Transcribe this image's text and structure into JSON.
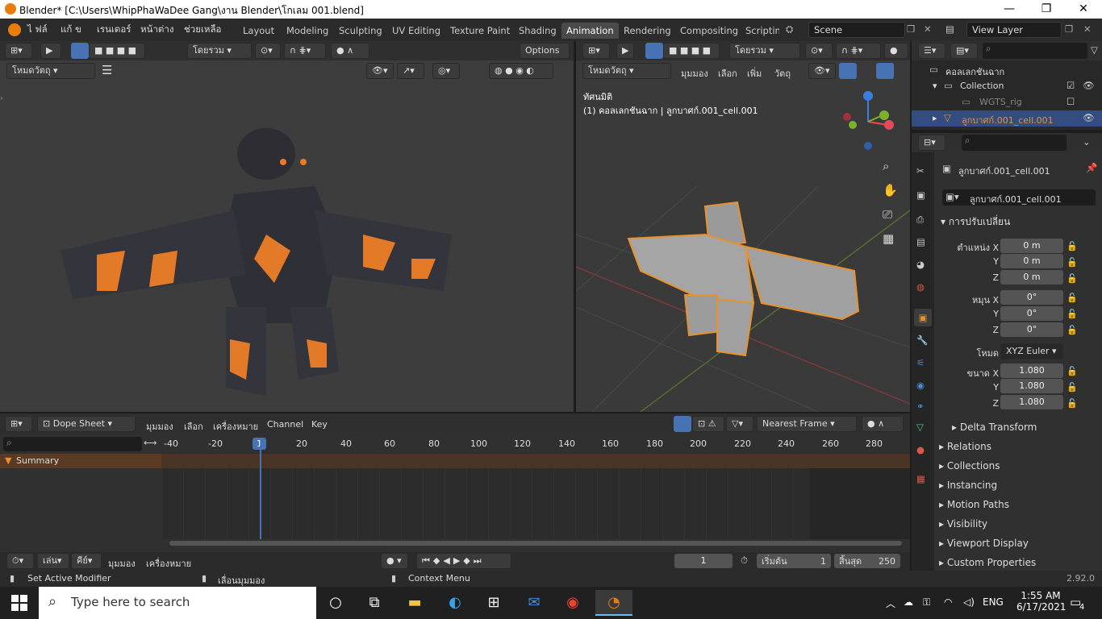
{
  "window": {
    "title": "Blender* [C:\\Users\\WhipPhaWaDee Gang\\งาน Blender\\โกเลม 001.blend]",
    "min": "—",
    "max": "❐",
    "close": "✕"
  },
  "menu": [
    "ไ ฟล์",
    "แก้ ข",
    "เรนเดอร์",
    "หน้าต่าง",
    "ช่วยเหลือ"
  ],
  "workspaces": [
    "Layout",
    "Modeling",
    "Sculpting",
    "UV Editing",
    "Texture Paint",
    "Shading",
    "Animation",
    "Rendering",
    "Compositing",
    "Scriptin"
  ],
  "active_workspace": "Animation",
  "scene": "Scene",
  "view_layer": "View Layer",
  "left_vp": {
    "orient": "โดยรวม",
    "mode": "โหมดวัตถุ",
    "options": "Options"
  },
  "right_vp": {
    "orient": "โดยรวม",
    "mode": "โหมดวัตถุ",
    "menus": [
      "มุมมอง",
      "เลือก",
      "เพิ่ม",
      "วัตถุ"
    ],
    "view_name": "ทัศนมิติ",
    "info": "(1) คอลเลกชันฉาก | ลูกบาศก์.001_cell.001"
  },
  "dope": {
    "editor": "Dope Sheet",
    "menus": [
      "มุมมอง",
      "เลือก",
      "เครื่องหมาย",
      "Channel",
      "Key"
    ],
    "snap": "Nearest Frame",
    "summary": "Summary",
    "ticks": [
      "-40",
      "-20",
      "1",
      "20",
      "40",
      "60",
      "80",
      "100",
      "120",
      "140",
      "160",
      "180",
      "200",
      "220",
      "240",
      "260",
      "280"
    ],
    "current_frame": "1"
  },
  "timeline": {
    "menus": [
      "เล่น",
      "คีย์",
      "มุมมอง",
      "เครื่องหมาย"
    ],
    "frame": "1",
    "start_label": "เริ่มต้น",
    "start": "1",
    "end_label": "สิ้นสุด",
    "end": "250"
  },
  "outliner": {
    "scene_coll": "คอลเลกชันฉาก",
    "collection": "Collection",
    "rig": "WGTS_rig",
    "object": "ลูกบาศก์.001_cell.001"
  },
  "props": {
    "object": "ลูกบาศก์.001_cell.001",
    "data": "ลูกบาศก์.001_cell.001",
    "transform": "การปรับเปลี่ยน",
    "loc_label": "ตำแหน่ง X",
    "rot_label": "หมุน X",
    "scale_label": "ขนาด X",
    "mode_label": "โหมด",
    "mode": "XYZ Euler",
    "loc": [
      "0 m",
      "0 m",
      "0 m"
    ],
    "rot": [
      "0°",
      "0°",
      "0°"
    ],
    "scale": [
      "1.080",
      "1.080",
      "1.080"
    ],
    "y": "Y",
    "z": "Z",
    "panels": [
      "Delta Transform",
      "Relations",
      "Collections",
      "Instancing",
      "Motion Paths",
      "Visibility",
      "Viewport Display",
      "Custom Properties"
    ]
  },
  "status": {
    "a": "Set Active Modifier",
    "b": "เลื่อนมุมมอง",
    "c": "Context Menu",
    "version": "2.92.0"
  },
  "taskbar": {
    "search": "Type here to search",
    "time": "1:55 AM",
    "date": "6/17/2021",
    "lang": "ENG",
    "notif": "4"
  }
}
